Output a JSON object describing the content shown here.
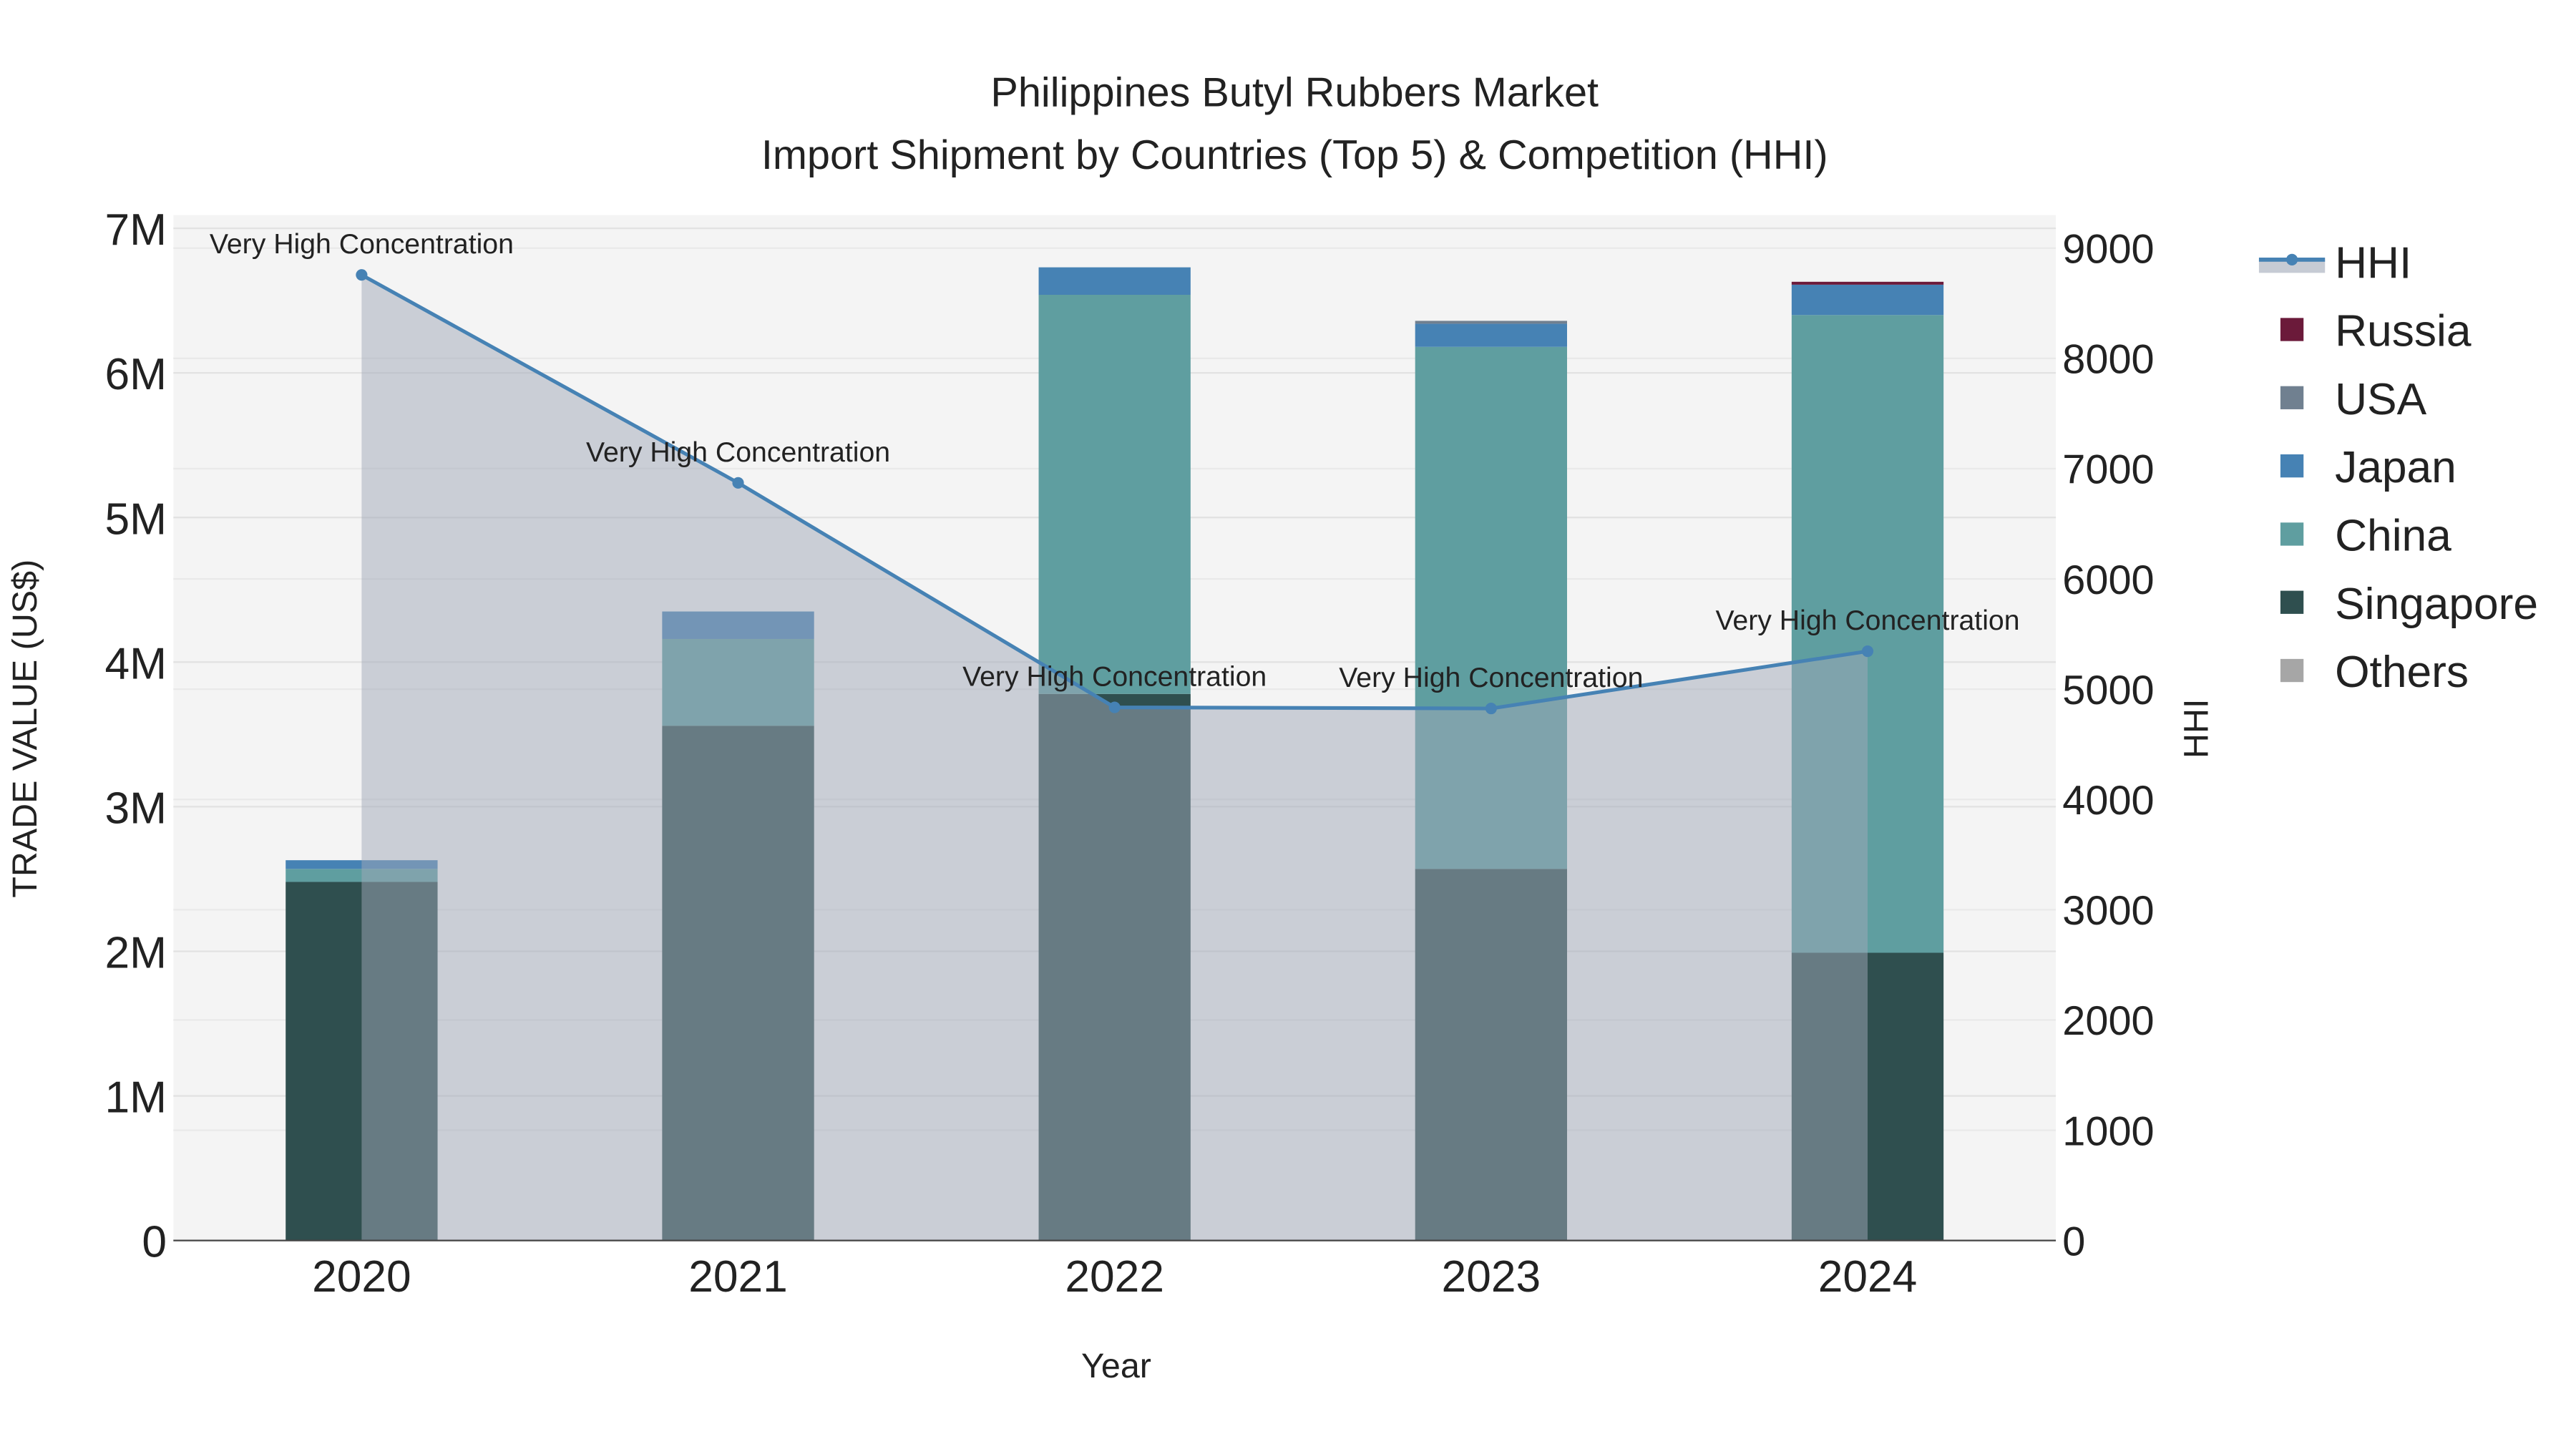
{
  "chart_data": {
    "type": "bar",
    "title": "Philippines Butyl Rubbers Market",
    "subtitle": "Import Shipment by Countries (Top 5) & Competition (HHI)",
    "xlabel": "Year",
    "ylabel": "TRADE VALUE (US$)",
    "y2label": "HHI",
    "categories": [
      "2020",
      "2021",
      "2022",
      "2023",
      "2024"
    ],
    "ylim": [
      0,
      7000000
    ],
    "y_ticks": [
      0,
      1000000,
      2000000,
      3000000,
      4000000,
      5000000,
      6000000,
      7000000
    ],
    "y_tick_labels": [
      "0",
      "1M",
      "2M",
      "3M",
      "4M",
      "5M",
      "6M",
      "7M"
    ],
    "y2lim": [
      0,
      9000
    ],
    "y2_ticks": [
      0,
      1000,
      2000,
      3000,
      4000,
      5000,
      6000,
      7000,
      8000,
      9000
    ],
    "y2_tick_labels": [
      "0",
      "1000",
      "2000",
      "3000",
      "4000",
      "5000",
      "6000",
      "7000",
      "8000",
      "9000"
    ],
    "grid": true,
    "legend_position": "right",
    "series": [
      {
        "name": "Others",
        "color": "#a6a6a6",
        "values": [
          0,
          0,
          0,
          0,
          0
        ]
      },
      {
        "name": "Singapore",
        "color": "#2f4f4f",
        "values": [
          2480000,
          3560000,
          3780000,
          2570000,
          1990000
        ]
      },
      {
        "name": "China",
        "color": "#5f9ea0",
        "values": [
          90000,
          600000,
          2760000,
          3610000,
          4410000
        ]
      },
      {
        "name": "Japan",
        "color": "#4682b4",
        "values": [
          60000,
          190000,
          190000,
          160000,
          210000
        ]
      },
      {
        "name": "USA",
        "color": "#708090",
        "values": [
          0,
          0,
          0,
          20000,
          0
        ]
      },
      {
        "name": "Russia",
        "color": "#6b1a3a",
        "values": [
          0,
          0,
          0,
          0,
          20000
        ]
      }
    ],
    "hhi": {
      "name": "HHI",
      "color": "#4682b4",
      "values": [
        8757,
        6871,
        4835,
        4825,
        5344
      ],
      "annotations": [
        "Very High Concentration",
        "Very High Concentration",
        "Very High Concentration",
        "Very High Concentration",
        "Very High Concentration"
      ]
    },
    "legend_order": [
      "HHI",
      "Russia",
      "USA",
      "Japan",
      "China",
      "Singapore",
      "Others"
    ]
  }
}
